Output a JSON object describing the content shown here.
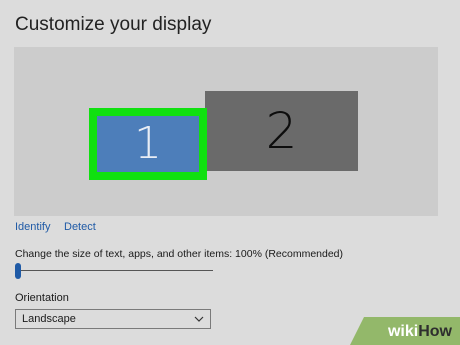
{
  "header": {
    "title": "Customize your display"
  },
  "display_arrangement": {
    "monitor_1_label": "1",
    "monitor_2_label": "2",
    "selected_monitor": "1",
    "colors": {
      "monitor_1": "#4d7eba",
      "monitor_2": "#6a6a6a",
      "selection_highlight": "#10e010"
    }
  },
  "actions": {
    "identify_label": "Identify",
    "detect_label": "Detect"
  },
  "scale": {
    "label": "Change the size of text, apps, and other items: 100% (Recommended)",
    "slider_level": 0
  },
  "orientation": {
    "label": "Orientation",
    "selected": "Landscape"
  },
  "watermark": {
    "text_part_1": "wiki",
    "text_part_2": "How"
  }
}
